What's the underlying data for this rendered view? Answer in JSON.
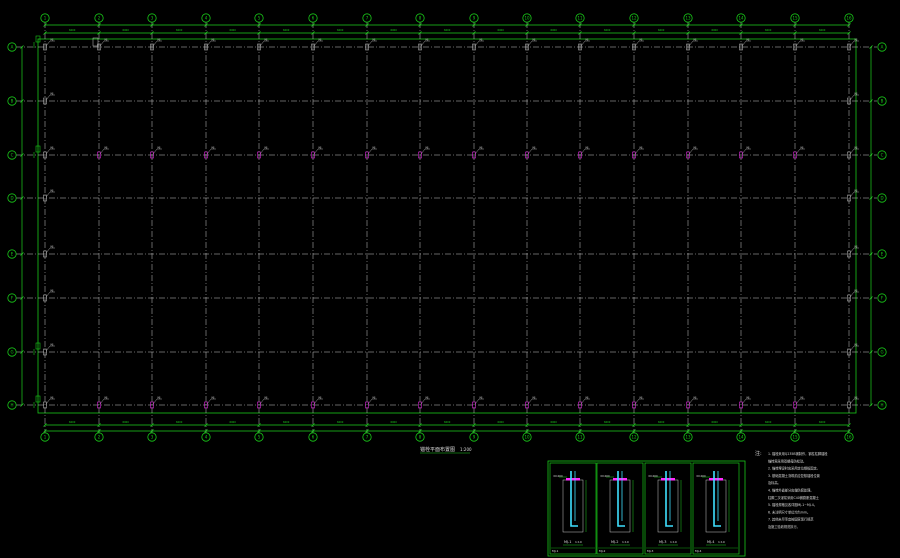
{
  "drawing": {
    "type": "cad-anchor-bolt-layout-plan",
    "colors": {
      "background": "#000000",
      "axis_green": "#19c819",
      "grid_line": "#c8c8c8",
      "dim_green": "#1ed21e",
      "tag_text": "#d0d0d0",
      "magenta": "#ff2aff",
      "cyan": "#3fe0ff",
      "note_white": "#dddddd"
    },
    "columns": {
      "count": 16,
      "labels": [
        "1",
        "2",
        "3",
        "4",
        "5",
        "6",
        "7",
        "8",
        "9",
        "10",
        "11",
        "12",
        "13",
        "14",
        "15",
        "16"
      ]
    },
    "rows": {
      "count": 8,
      "labels": [
        "A",
        "B",
        "C",
        "D",
        "E",
        "F",
        "G",
        "H"
      ]
    },
    "title": "锚栓平面布置图",
    "title_scale": "1:200",
    "detail_panels": [
      {
        "id": "MJ-1",
        "caption": "MJ-1",
        "scale": "1:10"
      },
      {
        "id": "MJ-2",
        "caption": "MJ-2",
        "scale": "1:10"
      },
      {
        "id": "MJ-3",
        "caption": "MJ-3",
        "scale": "1:10"
      },
      {
        "id": "MJ-4",
        "caption": "MJ-4",
        "scale": "1:10"
      }
    ],
    "notes_heading": "注:",
    "notes": [
      "1. 锚栓采用Q235B钢制作，钢柱柱脚锚栓",
      "   锚栓需采用双螺母防松动。",
      "2. 锚栓埋设时应采用定位钢板固定。",
      "3. 基础混凝土浇筑前应复核锚栓位置",
      "   及标高。",
      "4. 锚栓外露部分应做防腐处理。",
      "   柱脚二次灌浆采用C40微膨胀混凝土",
      "5. 锚栓规格见各详图MJ-1~MJ-4。",
      "6. 未注明尺寸单位均为mm。",
      "7. 其他未尽事宜按国家现行规范",
      "   及施工验收规范执行。"
    ]
  }
}
